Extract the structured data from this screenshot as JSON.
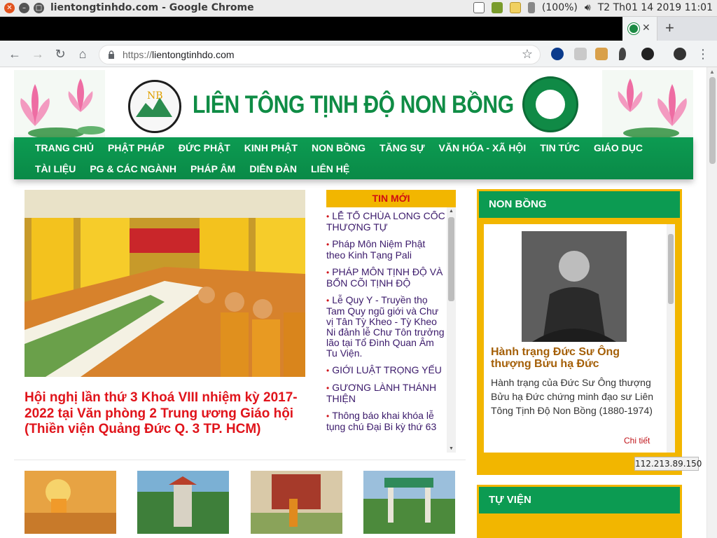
{
  "os_bar": {
    "window_title": "lientongtinhdo.com - Google Chrome",
    "battery": "(100%)",
    "clock": "T2 Th01 14 2019 11:01"
  },
  "browser": {
    "url_scheme": "https://",
    "url_host": "lientongtinhdo.com"
  },
  "site": {
    "title": "LIÊN TÔNG TỊNH ĐỘ NON BỒNG",
    "nav_row1": [
      "TRANG CHỦ",
      "PHẬT PHÁP",
      "ĐỨC PHẬT",
      "KINH PHẬT",
      "NON BỒNG",
      "TĂNG SỰ",
      "VĂN HÓA - XÃ HỘI",
      "TIN TỨC",
      "GIÁO DỤC"
    ],
    "nav_row2": [
      "TÀI LIỆU",
      "PG & CÁC NGÀNH",
      "PHÁP ÂM",
      "DIỄN ĐÀN",
      "LIÊN HỆ"
    ]
  },
  "featured": {
    "title": "Hội nghị lần thứ 3 Khoá VIII nhiệm kỳ 2017-2022 tại Văn phòng 2 Trung ương Giáo hội (Thiền viện Quảng Đức Q. 3 TP. HCM)"
  },
  "news": {
    "heading": "TIN MỚI",
    "items": [
      "LỄ TỔ CHÙA LONG CỐC THƯỢNG TỰ",
      "Pháp Môn Niệm Phật theo Kinh Tạng Pali",
      "PHÁP MÔN TỊNH ĐỘ VÀ BỔN CÕI TỊNH ĐỘ",
      "Lễ Quy Y - Truyền thọ Tam Quy ngũ giới và Chư vị Tân Tỳ Kheo - Tỳ Kheo Ni đảnh lễ Chư Tôn trưởng lão tại Tổ Đình Quan Âm Tu Viện.",
      "GIỚI LUẬT TRỌNG YẾU",
      "GƯƠNG LÀNH THÁNH THIỆN",
      "Thông báo khai khóa lễ tụng chú Đại Bi kỳ thứ 63"
    ]
  },
  "sidebar": {
    "non_bong": {
      "heading": "NON BỒNG",
      "title": "Hành trạng Đức Sư Ông thượng Bửu hạ Đức",
      "desc": "Hành trạng của Đức Sư Ông thượng Bửu hạ Đức chứng minh đạo sư Liên Tông Tịnh Độ Non Bồng (1880-1974)",
      "more": "Chi tiết"
    },
    "tu_vien": {
      "heading": "TỰ VIỆN"
    }
  },
  "status_tip": "112.213.89.150",
  "colors": {
    "brand_green": "#0c9b52",
    "accent_gold": "#f2b600",
    "headline_red": "#e0141b"
  }
}
